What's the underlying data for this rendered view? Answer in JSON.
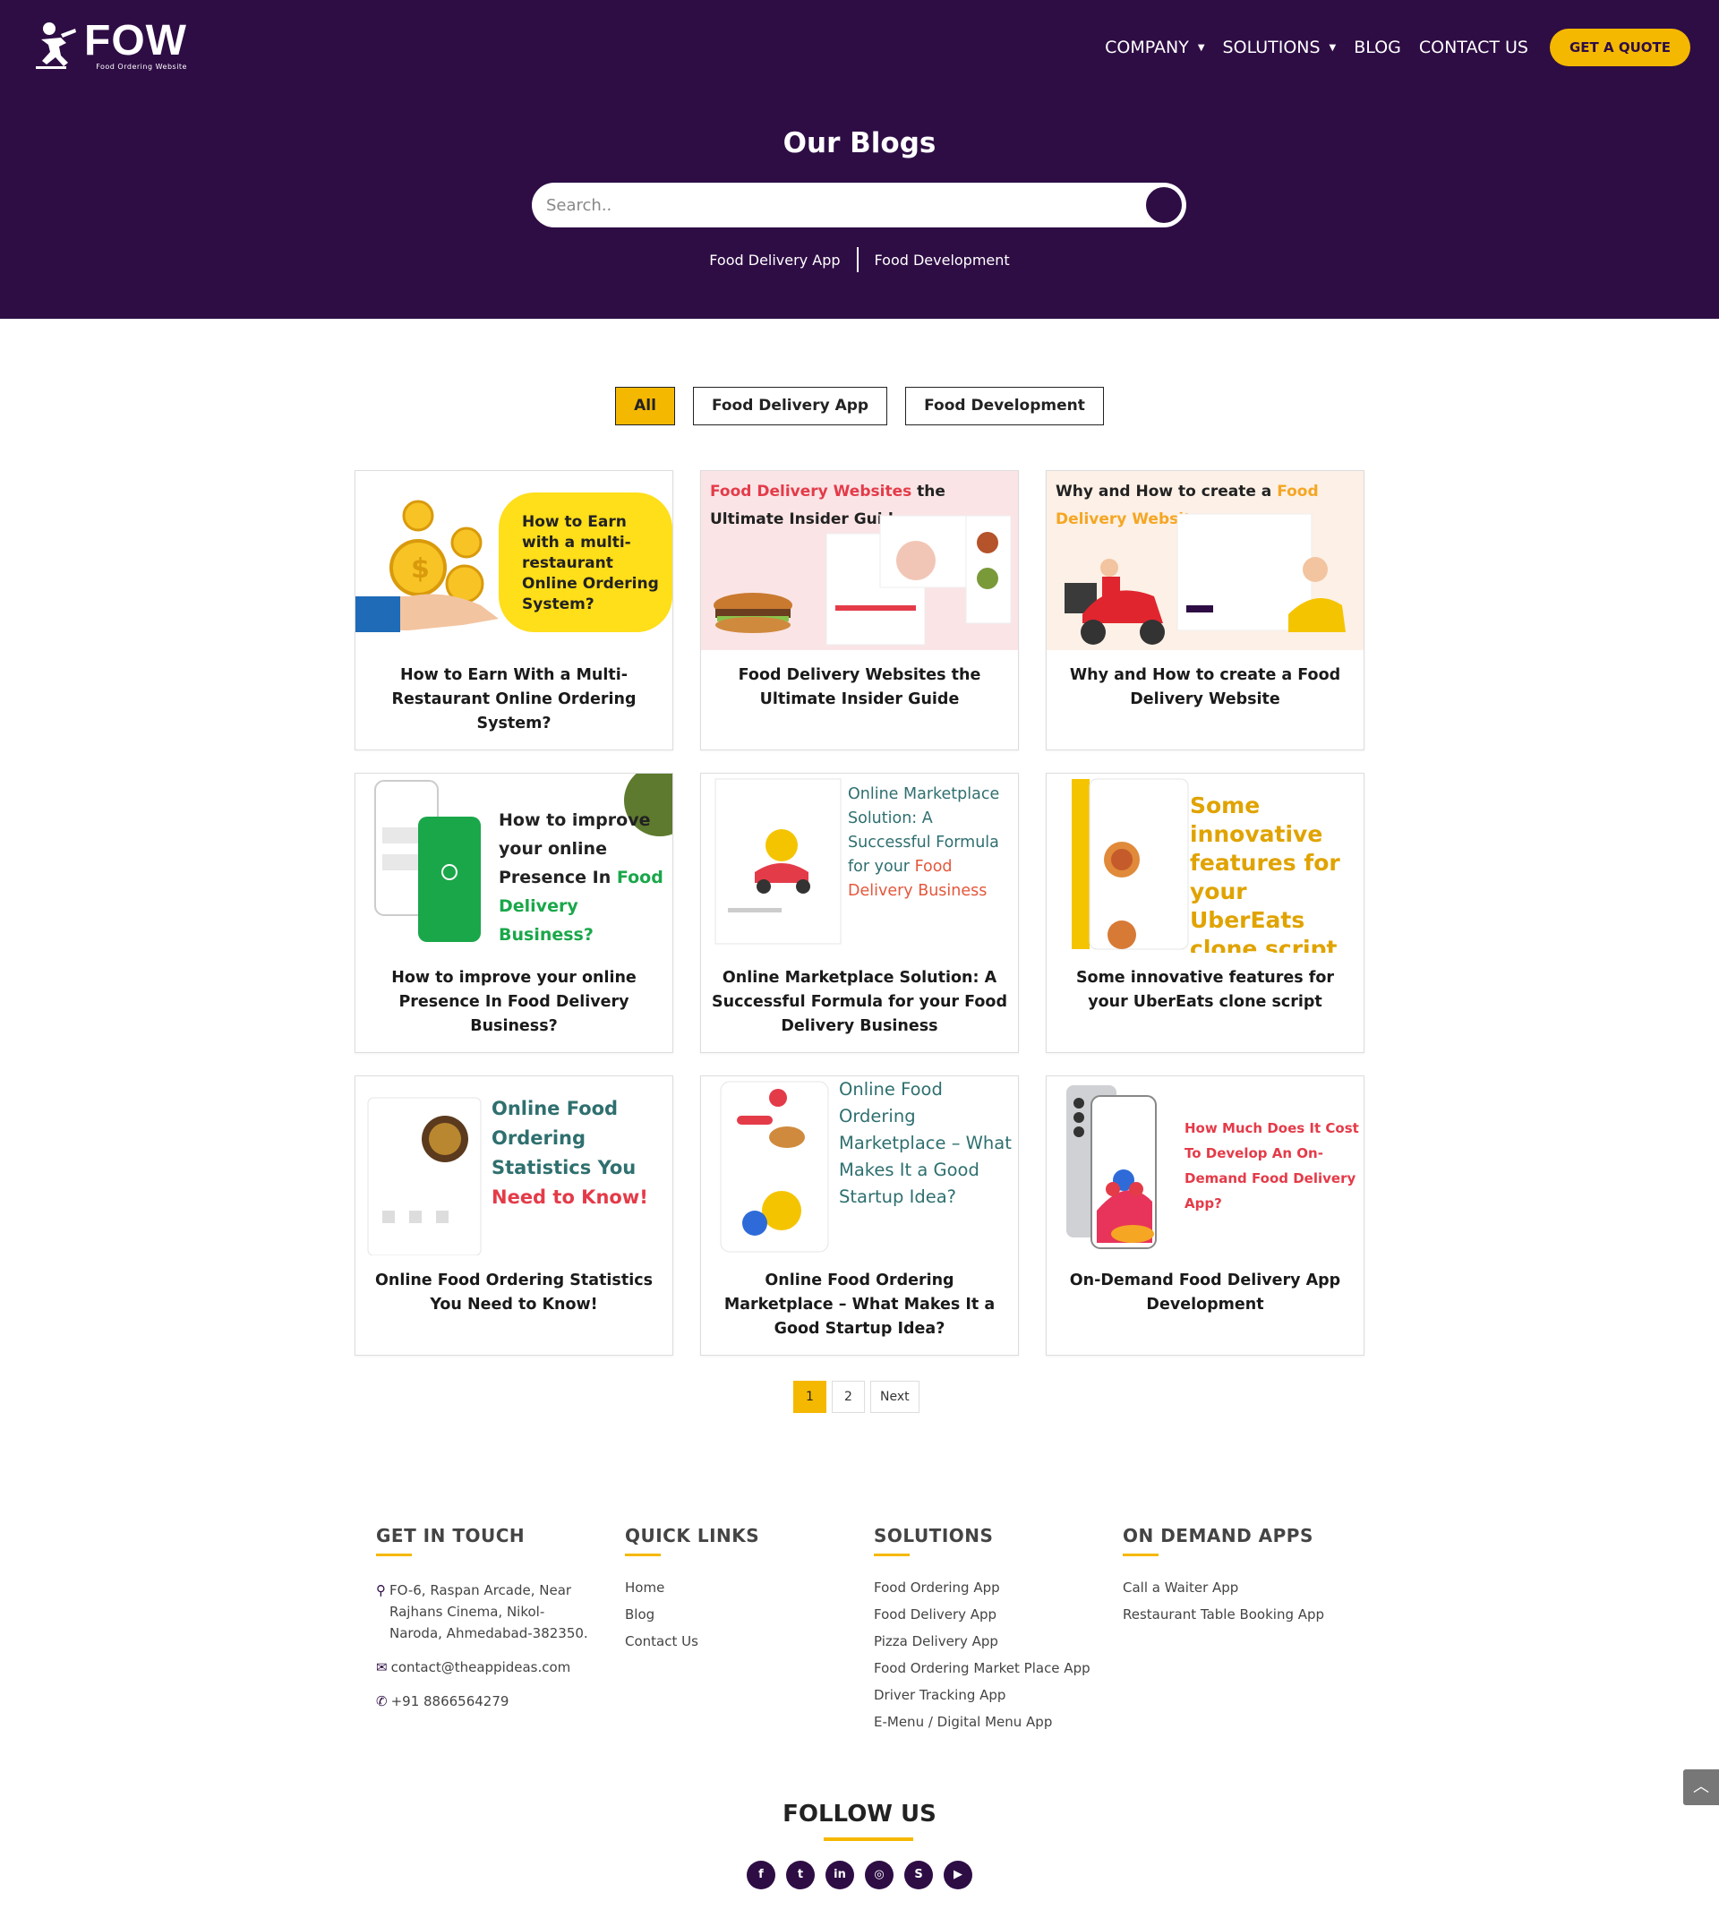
{
  "header": {
    "logo_text": "FOW",
    "logo_subtitle": "Food Ordering Website",
    "nav": [
      {
        "label": "COMPANY",
        "has_dropdown": true
      },
      {
        "label": "SOLUTIONS",
        "has_dropdown": true
      },
      {
        "label": "BLOG",
        "has_dropdown": false
      },
      {
        "label": "CONTACT US",
        "has_dropdown": false
      }
    ],
    "quote_button": "GET A QUOTE"
  },
  "hero": {
    "title": "Our Blogs",
    "search_placeholder": "Search..",
    "categories": [
      "Food Delivery App",
      "Food Development"
    ]
  },
  "filters": [
    "All",
    "Food Delivery App",
    "Food Development"
  ],
  "active_filter": "All",
  "posts": [
    {
      "title": "How to Earn With a Multi-Restaurant Online Ordering System?",
      "thumb_text": "How to Earn with a multi-restaurant Online Ordering System?"
    },
    {
      "title": "Food Delivery Websites the Ultimate Insider Guide",
      "thumb_highlight": "Food Delivery Websites",
      "thumb_text": "the Ultimate Insider Guide"
    },
    {
      "title": "Why and How to create a Food Delivery Website",
      "thumb_text": "Why and How to create a",
      "thumb_highlight": "Food Delivery Website."
    },
    {
      "title": "How to improve your online Presence In Food Delivery Business?",
      "thumb_text": "How to improve your online Presence In",
      "thumb_highlight": "Food Delivery Business?"
    },
    {
      "title": "Online Marketplace Solution: A Successful Formula for your Food Delivery Business",
      "thumb_text": "Online Marketplace Solution: A Successful Formula for your",
      "thumb_highlight": "Food Delivery Business"
    },
    {
      "title": "Some innovative features for your UberEats clone script",
      "thumb_text": "Some innovative features for your UberEats clone script"
    },
    {
      "title": "Online Food Ordering Statistics You Need to Know!",
      "thumb_text": "Online Food Ordering Statistics You",
      "thumb_highlight": "Need to Know!"
    },
    {
      "title": "Online Food Ordering Marketplace – What Makes It a Good Startup Idea?",
      "thumb_text": "Online Food Ordering Marketplace – What Makes It a Good Startup Idea?"
    },
    {
      "title": "On-Demand Food Delivery App Development",
      "thumb_text": "How Much Does It Cost To Develop An On-Demand Food Delivery App?"
    }
  ],
  "pagination": {
    "pages": [
      "1",
      "2"
    ],
    "current": "1",
    "next": "Next"
  },
  "footer": {
    "get_in_touch": {
      "heading": "GET IN TOUCH",
      "address": "FO-6, Raspan Arcade, Near Rajhans Cinema, Nikol-Naroda, Ahmedabad-382350.",
      "email": "contact@theappideas.com",
      "phone": "+91 8866564279"
    },
    "quick_links": {
      "heading": "QUICK LINKS",
      "links": [
        "Home",
        "Blog",
        "Contact Us"
      ]
    },
    "solutions": {
      "heading": "SOLUTIONS",
      "links": [
        "Food Ordering App",
        "Food Delivery App",
        "Pizza Delivery App",
        "Food Ordering Market Place App",
        "Driver Tracking App",
        "E-Menu / Digital Menu App"
      ]
    },
    "on_demand": {
      "heading": "ON DEMAND APPS",
      "links": [
        "Call a Waiter App",
        "Restaurant Table Booking App"
      ]
    },
    "follow_title": "FOLLOW US",
    "socials": [
      "facebook-icon",
      "twitter-icon",
      "linkedin-icon",
      "instagram-icon",
      "skype-icon",
      "youtube-icon"
    ]
  },
  "colors": {
    "brand_purple": "#2e0d45",
    "accent_yellow": "#f5b800",
    "highlight_orange": "#f5a623",
    "highlight_red": "#e43b49"
  }
}
